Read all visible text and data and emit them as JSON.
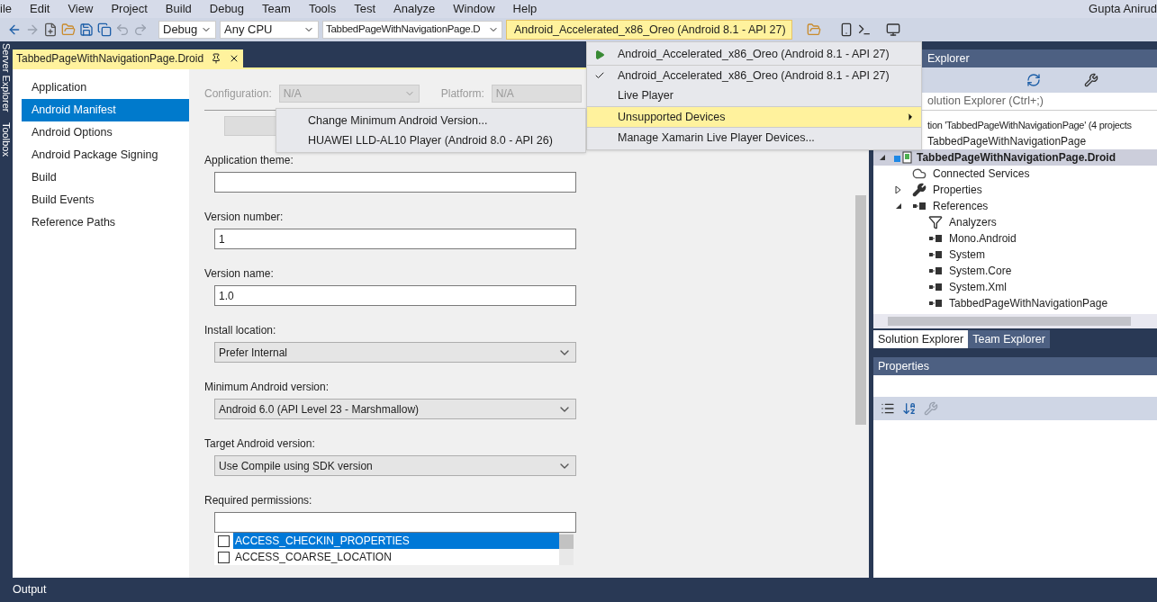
{
  "menu_bar": {
    "items": [
      "ile",
      "Edit",
      "View",
      "Project",
      "Build",
      "Debug",
      "Team",
      "Tools",
      "Test",
      "Analyze",
      "Window",
      "Help"
    ],
    "user": "Gupta Anirud"
  },
  "toolbar": {
    "configuration": "Debug",
    "platform": "Any CPU",
    "startup_project": "TabbedPageWithNavigationPage.D",
    "run_target": "Android_Accelerated_x86_Oreo (Android 8.1 - API 27)"
  },
  "side_strip": [
    "Server Explorer",
    "Toolbox"
  ],
  "document_tab": {
    "title": "TabbedPageWithNavigationPage.Droid",
    "selected": true
  },
  "nav": [
    {
      "label": "Application",
      "selected": false
    },
    {
      "label": "Android Manifest",
      "selected": true
    },
    {
      "label": "Android Options",
      "selected": false
    },
    {
      "label": "Android Package Signing",
      "selected": false
    },
    {
      "label": "Build",
      "selected": false
    },
    {
      "label": "Build Events",
      "selected": false
    },
    {
      "label": "Reference Paths",
      "selected": false
    }
  ],
  "form": {
    "configuration_label": "Configuration:",
    "configuration_value": "N/A",
    "platform_label": "Platform:",
    "platform_value": "N/A",
    "fields": [
      {
        "kind": "text",
        "label": "Application theme:"
      },
      {
        "kind": "text",
        "label": "Version number:",
        "value": "1"
      },
      {
        "kind": "text",
        "label": "Version name:",
        "value": "1.0"
      },
      {
        "kind": "select",
        "label": "Install location:",
        "value": "Prefer Internal"
      },
      {
        "kind": "select",
        "label": "Minimum Android version:",
        "value": "Android 6.0 (API Level 23 - Marshmallow)"
      },
      {
        "kind": "select",
        "label": "Target Android version:",
        "value": "Use Compile using SDK version"
      }
    ],
    "permissions_label": "Required permissions:",
    "permissions": [
      {
        "label": "ACCESS_CHECKIN_PROPERTIES",
        "checked": false,
        "selected": true
      },
      {
        "label": "ACCESS_COARSE_LOCATION",
        "checked": false,
        "selected": false
      }
    ]
  },
  "run_menu": {
    "items": [
      {
        "kind": "run",
        "label": "Android_Accelerated_x86_Oreo (Android 8.1 - API 27)"
      },
      {
        "kind": "check",
        "label": "Android_Accelerated_x86_Oreo (Android 8.1 - API 27)",
        "checked": true
      },
      {
        "kind": "check",
        "label": "Live Player",
        "checked": false
      },
      {
        "kind": "submenu",
        "label": "Unsupported Devices",
        "selected": true
      },
      {
        "kind": "plain",
        "label": "Manage Xamarin Live Player Devices..."
      }
    ]
  },
  "submenu": {
    "items": [
      "Change Minimum Android Version...",
      "HUAWEI LLD-AL10 Player (Android 8.0 - API 26)"
    ]
  },
  "solution_explorer": {
    "title": "Explorer",
    "search_placeholder": "olution Explorer (Ctrl+;)",
    "tree": [
      {
        "label": "tion 'TabbedPageWithNavigationPage' (4 projects",
        "children": [
          {
            "label": "TabbedPageWithNavigationPage"
          },
          {
            "kind": "project",
            "label": "TabbedPageWithNavigationPage.Droid",
            "selected": true,
            "expanded": true,
            "children": [
              {
                "kind": "service",
                "label": "Connected Services"
              },
              {
                "kind": "properties",
                "label": "Properties",
                "expanded": false
              },
              {
                "kind": "references",
                "label": "References",
                "expanded": true,
                "children": [
                  {
                    "kind": "analyzers",
                    "label": "Analyzers"
                  },
                  {
                    "kind": "reference",
                    "label": "Mono.Android"
                  },
                  {
                    "kind": "reference",
                    "label": "System"
                  },
                  {
                    "kind": "reference",
                    "label": "System.Core"
                  },
                  {
                    "kind": "reference",
                    "label": "System.Xml"
                  },
                  {
                    "kind": "reference",
                    "label": "TabbedPageWithNavigationPage"
                  }
                ]
              }
            ]
          }
        ]
      }
    ],
    "tabs": [
      {
        "label": "Solution Explorer",
        "selected": true
      },
      {
        "label": "Team Explorer",
        "selected": false
      }
    ]
  },
  "properties": {
    "title": "Properties"
  },
  "status_bar": {
    "label": "Output"
  }
}
